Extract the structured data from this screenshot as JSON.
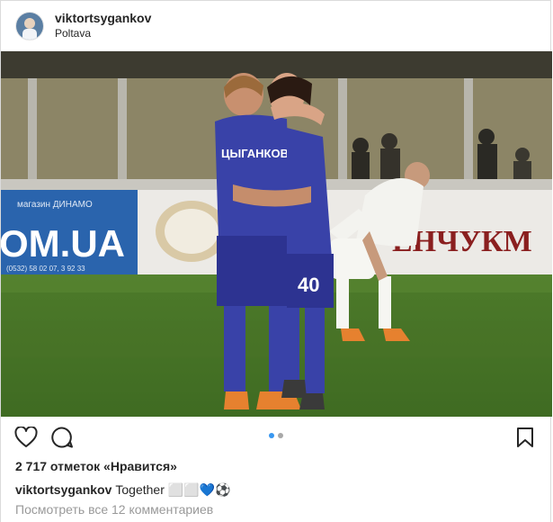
{
  "post": {
    "username": "viktortsygankov",
    "location": "Poltava",
    "likes_text": "2 717 отметок «Нравится»",
    "caption_user": "viktortsygankov",
    "caption_text": "Together ⬜⬜💙⚽",
    "view_comments": "Посмотреть все 12 комментариев"
  },
  "media": {
    "ad_left": "OM.UA",
    "ad_left_top": "магазин ДИНАМО",
    "ad_left_phone": "(0532) 58 02 07, 3 92 33",
    "ad_right": "ЕНЧУКМ",
    "player_front_name": "ЦЫГАНКОВ",
    "player_back_number": "40"
  },
  "carousel": {
    "count": 2,
    "active": 0
  },
  "colors": {
    "accent": "#3897f0",
    "muted": "#999999",
    "text": "#262626"
  }
}
